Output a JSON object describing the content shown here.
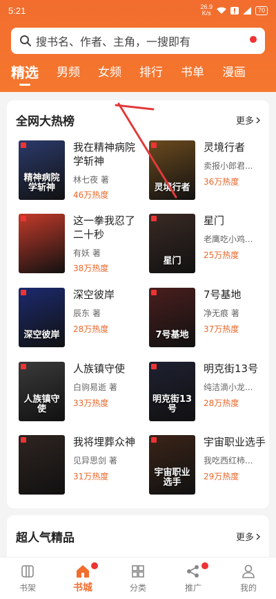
{
  "status": {
    "time": "5:21",
    "net_speed": "26.9",
    "net_unit": "K/s",
    "battery": "70"
  },
  "search": {
    "placeholder": "搜书名、作者、主角，一搜即有"
  },
  "tabs": [
    "精选",
    "男频",
    "女频",
    "排行",
    "书单",
    "漫画"
  ],
  "hot_section": {
    "title": "全网大热榜",
    "more": "更多"
  },
  "books": [
    {
      "title": "我在精神病院学斩神",
      "author": "林七夜 著",
      "heat": "46万热度",
      "cover_text": "精神病院学斩神",
      "cover_color": "#2b3a6b"
    },
    {
      "title": "灵境行者",
      "author": "卖报小郎君...",
      "heat": "36万热度",
      "cover_text": "灵境行者",
      "cover_color": "#6b4a1e"
    },
    {
      "title": "这一拳我忍了二十秒",
      "author": "有妖 著",
      "heat": "38万热度",
      "cover_text": "",
      "cover_color": "#c23a2a"
    },
    {
      "title": "星门",
      "author": "老鹰吃小鸡...",
      "heat": "25万热度",
      "cover_text": "星门",
      "cover_color": "#3a2a24"
    },
    {
      "title": "深空彼岸",
      "author": "辰东 著",
      "heat": "28万热度",
      "cover_text": "深空彼岸",
      "cover_color": "#1c2a6e"
    },
    {
      "title": "7号基地",
      "author": "净无痕 著",
      "heat": "37万热度",
      "cover_text": "7号基地",
      "cover_color": "#4a1e1e"
    },
    {
      "title": "人族镇守使",
      "author": "白驹易逝 著",
      "heat": "33万热度",
      "cover_text": "人族镇守使",
      "cover_color": "#3a3a3a"
    },
    {
      "title": "明克街13号",
      "author": "纯洁滴小龙...",
      "heat": "28万热度",
      "cover_text": "明克街13号",
      "cover_color": "#1e2030"
    },
    {
      "title": "我将埋葬众神",
      "author": "见异思剑 著",
      "heat": "31万热度",
      "cover_text": "",
      "cover_color": "#2e2420"
    },
    {
      "title": "宇宙职业选手",
      "author": "我吃西红柿...",
      "heat": "29万热度",
      "cover_text": "宇宙职业选手",
      "cover_color": "#3a2418"
    }
  ],
  "popular_section": {
    "title": "超人气精品",
    "more": "更多"
  },
  "tabbar": [
    {
      "label": "书架",
      "icon": "bookshelf-icon"
    },
    {
      "label": "书城",
      "icon": "home-icon"
    },
    {
      "label": "分类",
      "icon": "category-icon"
    },
    {
      "label": "推广",
      "icon": "share-icon"
    },
    {
      "label": "我的",
      "icon": "profile-icon"
    }
  ],
  "colors": {
    "brand": "#f26d2e",
    "heat": "#e8672a",
    "badge": "#e33333"
  }
}
